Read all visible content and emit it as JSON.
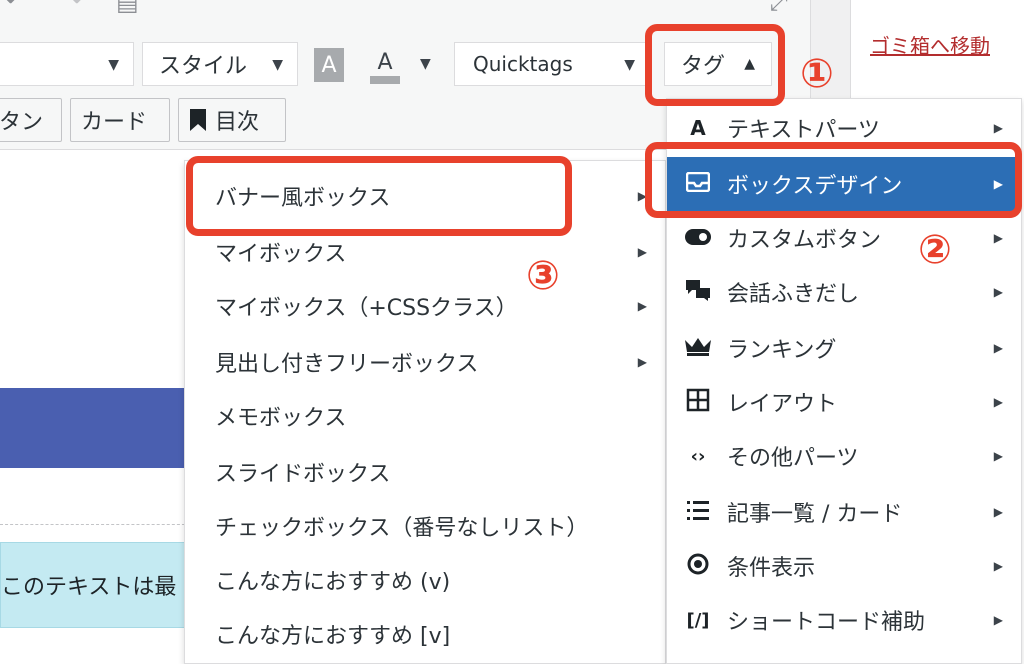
{
  "toolbar": {
    "style_label": "スタイル",
    "a_label": "A",
    "a_underline_label": "A",
    "quicktags_label": "Quicktags",
    "tag_label": "タグ",
    "tag_caret": "▲",
    "caret_down": "▼",
    "row2": {
      "button_partial": "タン",
      "card": "カード",
      "toc": "目次"
    }
  },
  "side_panel": {
    "trash_link": "ゴミ箱へ移動"
  },
  "content": {
    "cyan_text": "このテキストは最"
  },
  "tag_menu": {
    "items": [
      {
        "label": "テキストパーツ",
        "icon": "text-a-icon"
      },
      {
        "label": "ボックスデザイン",
        "icon": "box-tray-icon"
      },
      {
        "label": "カスタムボタン",
        "icon": "toggle-icon"
      },
      {
        "label": "会話ふきだし",
        "icon": "speech-bubbles-icon"
      },
      {
        "label": "ランキング",
        "icon": "crown-icon"
      },
      {
        "label": "レイアウト",
        "icon": "grid-icon"
      },
      {
        "label": "その他パーツ",
        "icon": "code-icon"
      },
      {
        "label": "記事一覧 / カード",
        "icon": "list-icon"
      },
      {
        "label": "条件表示",
        "icon": "eye-icon"
      },
      {
        "label": "ショートコード補助",
        "icon": "shortcode-icon"
      }
    ],
    "active_index": 1
  },
  "box_submenu": {
    "items": [
      {
        "label": "バナー風ボックス",
        "has_sub": true
      },
      {
        "label": "マイボックス",
        "has_sub": true
      },
      {
        "label": "マイボックス（+CSSクラス）",
        "has_sub": true
      },
      {
        "label": "見出し付きフリーボックス",
        "has_sub": true
      },
      {
        "label": "メモボックス",
        "has_sub": false
      },
      {
        "label": "スライドボックス",
        "has_sub": false
      },
      {
        "label": "チェックボックス（番号なしリスト）",
        "has_sub": false
      },
      {
        "label": "こんな方におすすめ (v)",
        "has_sub": false
      },
      {
        "label": "こんな方におすすめ [v]",
        "has_sub": false
      }
    ]
  },
  "annotations": {
    "step1": "①",
    "step2": "②",
    "step3": "③"
  },
  "colors": {
    "highlight": "#e8412c",
    "menu_active": "#2c6eb5",
    "content_blue": "#4a5fb0",
    "content_cyan": "#c4eaf2",
    "trash_link": "#b32d2e"
  }
}
